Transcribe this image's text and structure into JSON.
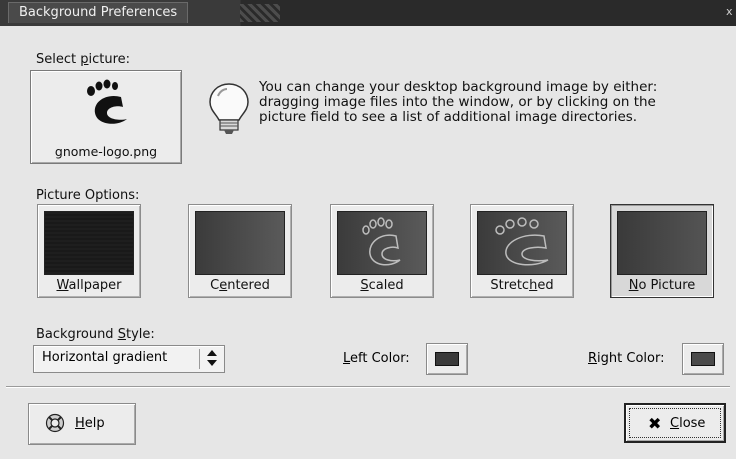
{
  "window": {
    "title": "Background Preferences",
    "close_glyph": "x"
  },
  "select_picture": {
    "label_prefix": "Select ",
    "label_mnemonic": "p",
    "label_suffix": "icture:",
    "filename": "gnome-logo.png",
    "icon": "gnome-foot-icon"
  },
  "info": {
    "icon": "lightbulb-icon",
    "lines": [
      "You can change your desktop background image by either:",
      "dragging image files into the window, or by clicking on the",
      "picture field to see a list of additional image directories."
    ]
  },
  "picture_options": {
    "label": "Picture Options:",
    "options": [
      {
        "pre": "",
        "mn": "W",
        "post": "allpaper",
        "selected": false
      },
      {
        "pre": "C",
        "mn": "e",
        "post": "ntered",
        "selected": false
      },
      {
        "pre": "",
        "mn": "S",
        "post": "caled",
        "selected": false
      },
      {
        "pre": "Stretc",
        "mn": "h",
        "post": "ed",
        "selected": false
      },
      {
        "pre": "",
        "mn": "N",
        "post": "o Picture",
        "selected": true
      }
    ]
  },
  "background_style": {
    "label_prefix": "Background ",
    "label_mnemonic": "S",
    "label_suffix": "tyle:",
    "value": "Horizontal gradient",
    "arrows": "▲▼"
  },
  "colors": {
    "left_label_mn": "L",
    "left_label_rest": "eft Color:",
    "left_color": "#3a3a3a",
    "right_label_mn": "R",
    "right_label_rest": "ight Color:",
    "right_color": "#4a4a4a"
  },
  "buttons": {
    "help_mn": "H",
    "help_rest": "elp",
    "help_icon": "lifebuoy-icon",
    "close_mn": "C",
    "close_rest": "lose",
    "close_glyph": "✖"
  }
}
